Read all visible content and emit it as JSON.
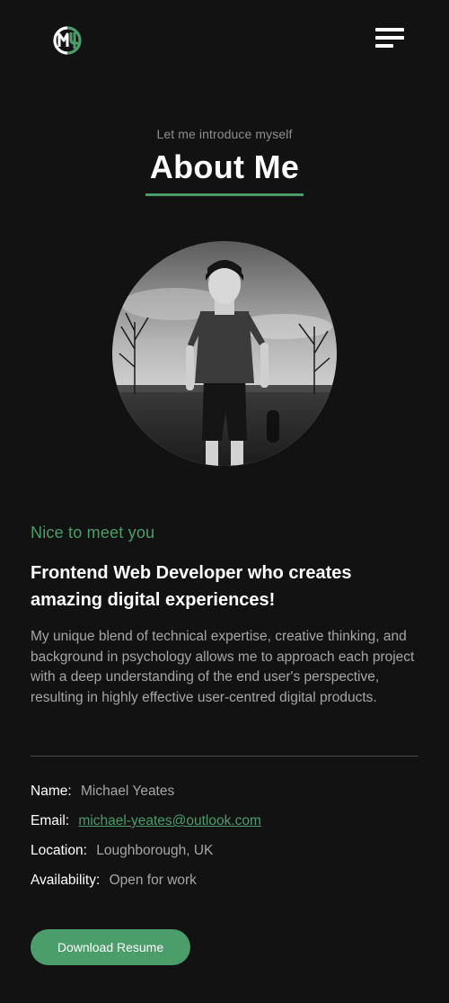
{
  "header": {
    "logo_icon": "mb-monogram-logo",
    "menu_icon": "hamburger-menu-icon"
  },
  "about": {
    "intro": "Let me introduce myself",
    "title": "About Me",
    "portrait_icon": "profile-photo-cyclist",
    "tagline": "Nice to meet you",
    "headline": "Frontend Web Developer who creates amazing digital experiences!",
    "bio": "My unique blend of technical expertise, creative thinking, and background in psychology allows me to approach each project with a deep understanding of the end user's perspective, resulting in highly effective user-centred digital products."
  },
  "details": {
    "name_label": "Name:",
    "name_value": "Michael Yeates",
    "email_label": "Email:",
    "email_value": "michael-yeates@outlook.com",
    "location_label": "Location:",
    "location_value": "Loughborough, UK",
    "availability_label": "Availability:",
    "availability_value": "Open for work"
  },
  "actions": {
    "download_label": "Download Resume"
  },
  "colors": {
    "background": "#121212",
    "accent": "#4b9d6a",
    "text_primary": "#ffffff",
    "text_secondary": "#a6a6a6"
  }
}
